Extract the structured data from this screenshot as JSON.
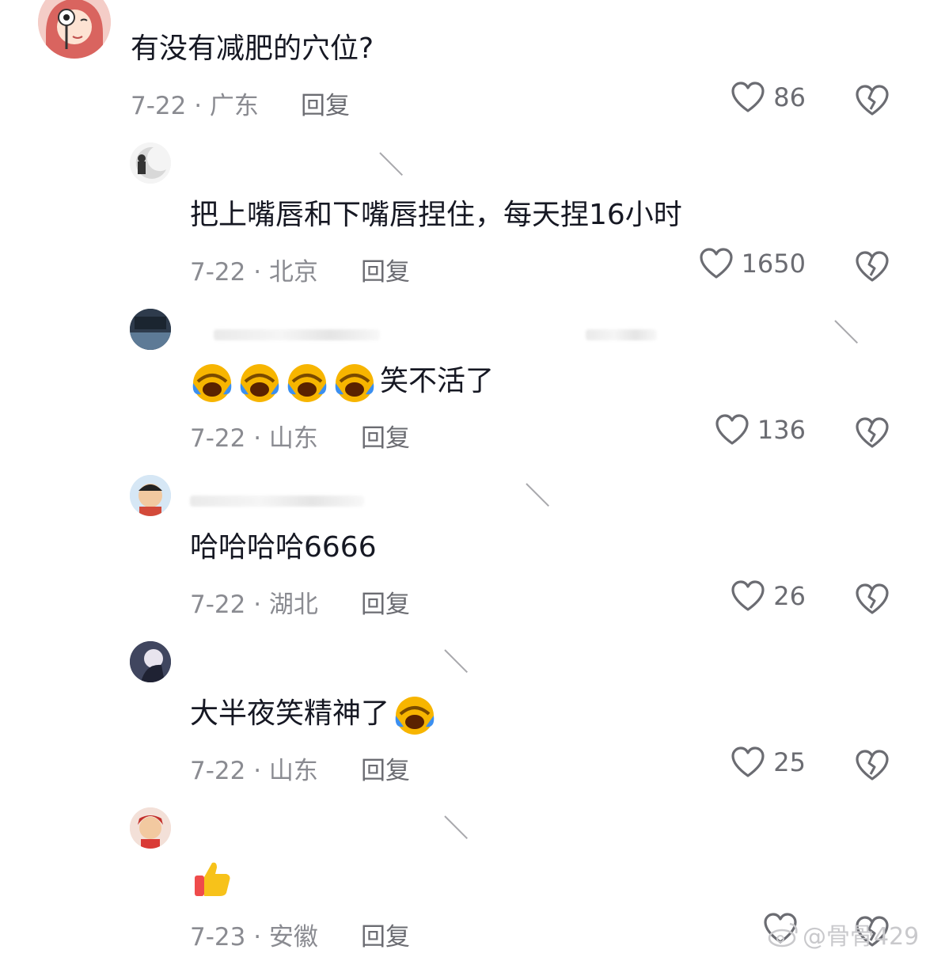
{
  "comments": [
    {
      "text": "有没有减肥的穴位?",
      "meta": "7-22 · 广东",
      "reply": "回复",
      "likes": "86"
    },
    {
      "text": "把上嘴唇和下嘴唇捏住，每天捏16小时",
      "meta": "7-22 · 北京",
      "reply": "回复",
      "likes": "1650"
    },
    {
      "text": "笑不活了",
      "meta": "7-22 · 山东",
      "reply": "回复",
      "likes": "136"
    },
    {
      "text": "哈哈哈哈6666",
      "meta": "7-22 · 湖北",
      "reply": "回复",
      "likes": "26"
    },
    {
      "text": "大半夜笑精神了",
      "meta": "7-22 · 山东",
      "reply": "回复",
      "likes": "25"
    },
    {
      "text": "",
      "meta": "7-23 · 安徽",
      "reply": "回复",
      "likes": ""
    }
  ],
  "watermark": "@骨骨429",
  "colors": {
    "text": "#161823",
    "meta": "#8a8b91",
    "icon": "#6b6c72",
    "emoji_yellow": "#f7b500",
    "emoji_blue": "#3b8ff0"
  },
  "icons": {
    "like": "heart-outline-icon",
    "dislike": "broken-heart-icon",
    "laugh": "laughing-crying-emoji",
    "thumbs": "thumbs-up-emoji"
  }
}
